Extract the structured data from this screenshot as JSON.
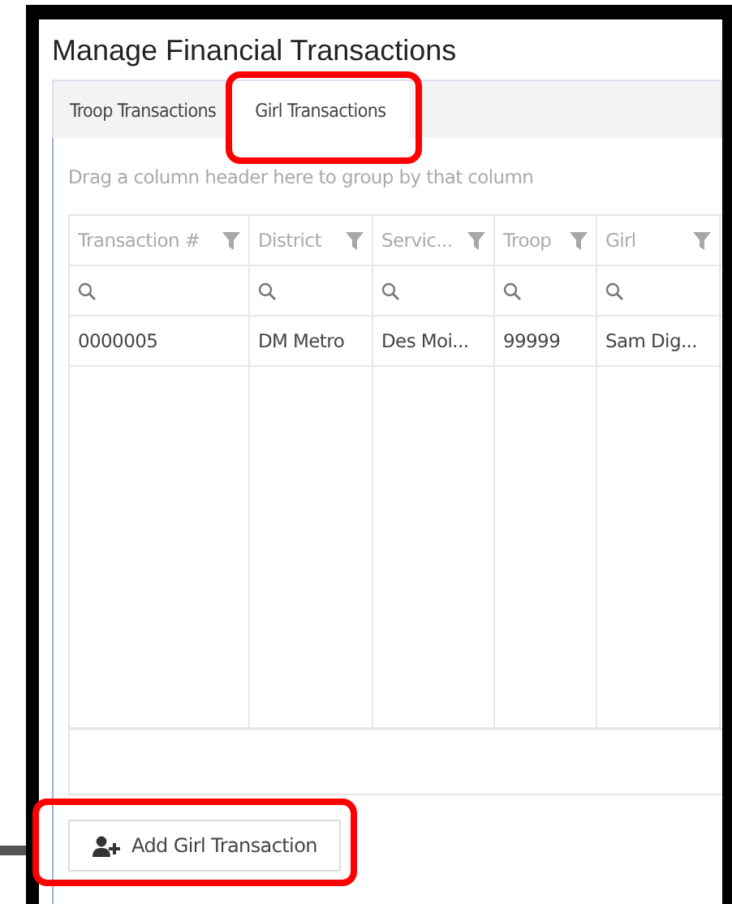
{
  "title": "Manage Financial Transactions",
  "tabs": [
    {
      "label": "Troop Transactions",
      "selected": false,
      "highlighted": false
    },
    {
      "label": "Girl Transactions",
      "selected": true,
      "highlighted": true
    }
  ],
  "group_hint": "Drag a column header here to group by that column",
  "table": {
    "columns": [
      "Transaction #",
      "District",
      "Servic...",
      "Troop",
      "Girl"
    ],
    "rows": [
      [
        "0000005",
        "DM Metro",
        "Des Moi...",
        "99999",
        "Sam Dig..."
      ]
    ]
  },
  "add_button": {
    "label": "Add Girl Transaction",
    "highlighted": true
  }
}
